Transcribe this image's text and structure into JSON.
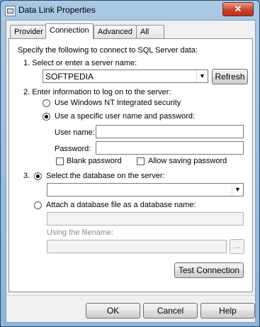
{
  "window": {
    "title": "Data Link Properties",
    "close_label": "✕"
  },
  "tabs": [
    {
      "label": "Provider"
    },
    {
      "label": "Connection"
    },
    {
      "label": "Advanced"
    },
    {
      "label": "All"
    }
  ],
  "connection": {
    "intro": "Specify the following to connect to SQL Server data:",
    "step1_label": "1. Select or enter a server name:",
    "server_value": "SOFTPEDIA",
    "refresh_label": "Refresh",
    "step2_label": "2. Enter information to log on to the server:",
    "radio_nt": "Use Windows NT Integrated security",
    "radio_specific": "Use a specific user name and password:",
    "username_label": "User name:",
    "username_value": "",
    "password_label": "Password:",
    "password_value": "",
    "blank_password": "Blank password",
    "allow_saving": "Allow saving password",
    "step3_number": "3.",
    "radio_select_db": "Select the database on the server:",
    "database_value": "",
    "radio_attach": "Attach a database file as a database name:",
    "attach_name_value": "",
    "using_filename_label": "Using the filename:",
    "filename_value": "",
    "browse_label": "...",
    "test_label": "Test Connection"
  },
  "footer": {
    "ok": "OK",
    "cancel": "Cancel",
    "help": "Help"
  }
}
